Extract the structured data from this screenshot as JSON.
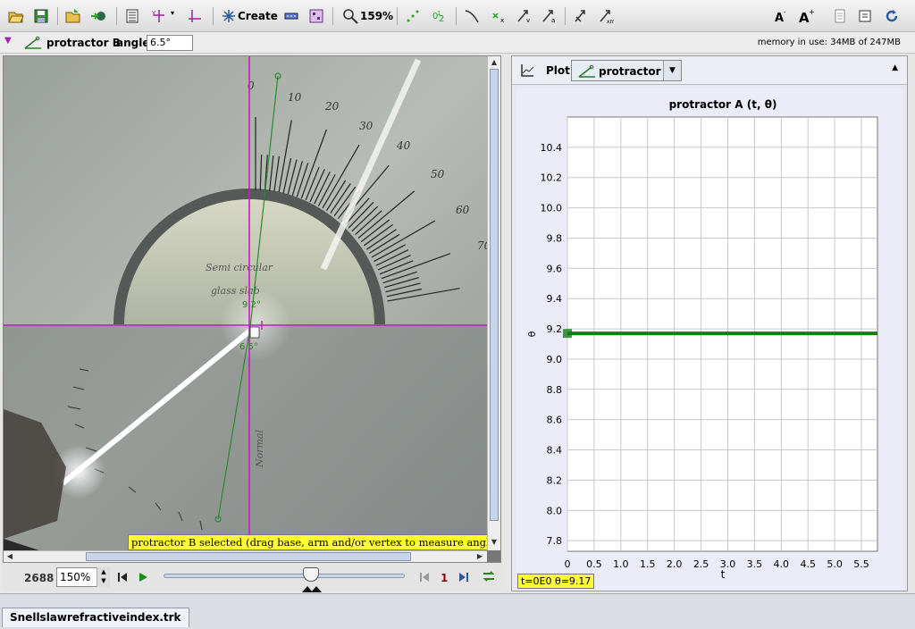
{
  "toolbar": {
    "create_label": "Create",
    "zoom_label": "159%",
    "icons": [
      "open-icon",
      "save-icon",
      "open-video-icon",
      "export-icon",
      "clip-settings-icon",
      "axes-icon",
      "tape-measure-icon",
      "create-track-icon",
      "calibration-icon",
      "filter-icon",
      "zoom-icon",
      "points-icon",
      "numbers-icon",
      "trail-icon",
      "position-icon",
      "velocity-icon",
      "acceleration-icon",
      "vector-stretch-icon",
      "vector-sum-icon",
      "font-smaller-icon",
      "font-larger-icon",
      "notes-icon",
      "info-icon",
      "refresh-icon"
    ]
  },
  "selection_bar": {
    "track_name": "protractor B",
    "angle_label": "angle",
    "angle_value": "6.5°",
    "memory": "memory in use: 34MB of 247MB"
  },
  "video": {
    "status": "protractor B selected (drag base, arm and/or vertex to measure angles)",
    "angle_label_a": "9.2°",
    "angle_label_b": "6.5°",
    "scale_labels": [
      "0",
      "10",
      "20",
      "30",
      "40",
      "50",
      "60",
      "70"
    ],
    "handwriting_1": "Semi  circular",
    "handwriting_2": "glass slab",
    "normal_label": "Normal"
  },
  "player": {
    "frame": "2688",
    "zoom": "150%",
    "step": "1",
    "position_fraction": 0.61
  },
  "plot": {
    "button_label": "Plot",
    "track_label": "protractor A",
    "readout": "t=0E0  θ=9.17"
  },
  "chart_data": {
    "type": "line",
    "title": "protractor A (t, θ)",
    "xlabel": "t",
    "ylabel": "θ",
    "xlim": [
      0,
      5.8
    ],
    "ylim": [
      7.73,
      10.6
    ],
    "x_ticks": [
      "0",
      "0.5",
      "1.0",
      "1.5",
      "2.0",
      "2.5",
      "3.0",
      "3.5",
      "4.0",
      "4.5",
      "5.0",
      "5.5"
    ],
    "y_ticks": [
      "10.4",
      "10.2",
      "10.0",
      "9.8",
      "9.6",
      "9.4",
      "9.2",
      "9.0",
      "8.8",
      "8.6",
      "8.4",
      "8.2",
      "8.0",
      "7.8"
    ],
    "grid": true,
    "series": [
      {
        "color": "#1a7a1a",
        "points": [
          [
            0,
            9.17
          ],
          [
            5.8,
            9.17
          ]
        ]
      }
    ]
  },
  "bottom": {
    "file_tab": "Snellslawrefractiveindex.trk"
  }
}
